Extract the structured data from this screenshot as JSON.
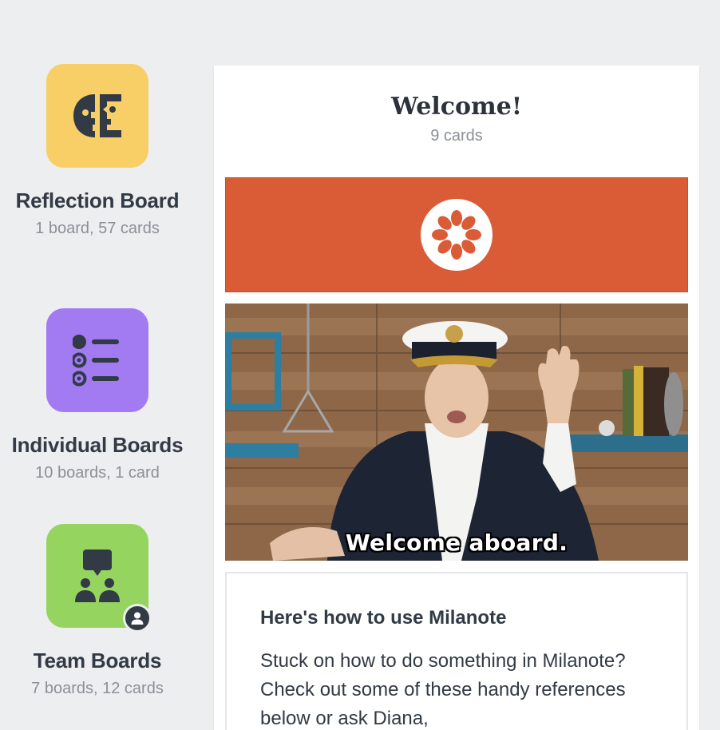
{
  "boards": [
    {
      "title": "Reflection Board",
      "meta": "1 board, 57 cards",
      "color": "#f7cf66",
      "icon": "face-profiles-icon"
    },
    {
      "title": "Individual Boards",
      "meta": "10 boards, 1 card",
      "color": "#a27bf3",
      "icon": "list-icon"
    },
    {
      "title": "Team Boards",
      "meta": "7 boards, 12 cards",
      "color": "#95d45e",
      "icon": "team-chat-icon",
      "badge_icon": "person-icon"
    }
  ],
  "column": {
    "title": "Welcome!",
    "count": "9 cards",
    "logo_color": "#d95c37",
    "gif_caption": "Welcome aboard.",
    "note": {
      "heading": "Here's how to use Milanote",
      "body": "Stuck on how to do something in Milanote?  Check out some of these handy references below or ask Diana,"
    }
  }
}
